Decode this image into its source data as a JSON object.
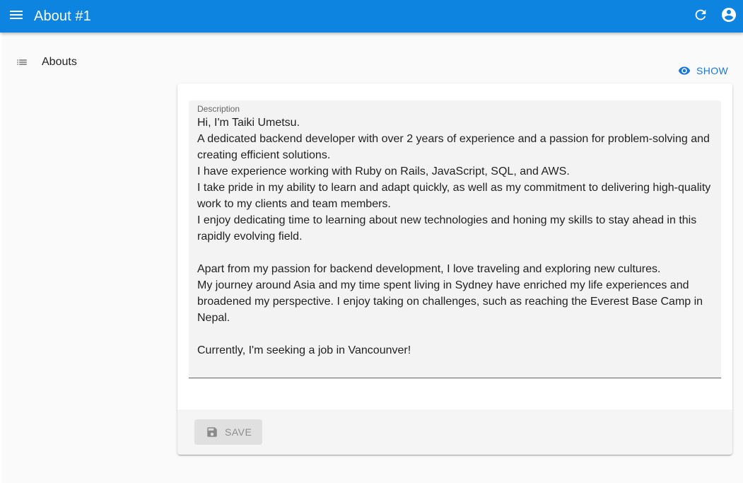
{
  "app": {
    "title": "About #1"
  },
  "appbar_icons": {
    "menu": "menu-icon",
    "refresh": "refresh-icon",
    "account": "account-circle-icon"
  },
  "sidebar": {
    "items": [
      {
        "label": "Abouts",
        "icon": "list-icon"
      }
    ]
  },
  "actions": {
    "show_label": "SHOW",
    "show_icon": "eye-icon"
  },
  "form": {
    "description_label": "Description",
    "description_value": "Hi, I'm Taiki Umetsu.\nA dedicated backend developer with over 2 years of experience and a passion for problem-solving and creating efficient solutions.\nI have experience working with Ruby on Rails, JavaScript, SQL, and AWS.\nI take pride in my ability to learn and adapt quickly, as well as my commitment to delivering high-quality work to my clients and team members.\nI enjoy dedicating time to learning about new technologies and honing my skills to stay ahead in this rapidly evolving field.\n\nApart from my passion for backend development, I love traveling and exploring new cultures.\nMy journey around Asia and my time spent living in Sydney have enriched my life experiences and broadened my perspective. I enjoy taking on challenges, such as reaching the Everest Base Camp in Nepal.\n\nCurrently, I'm seeking a job in Vancounver!"
  },
  "toolbar": {
    "save_label": "SAVE",
    "save_icon": "save-icon"
  },
  "colors": {
    "appbar": "#0d84e0",
    "accent": "#1976d2",
    "background": "#fafafa"
  }
}
